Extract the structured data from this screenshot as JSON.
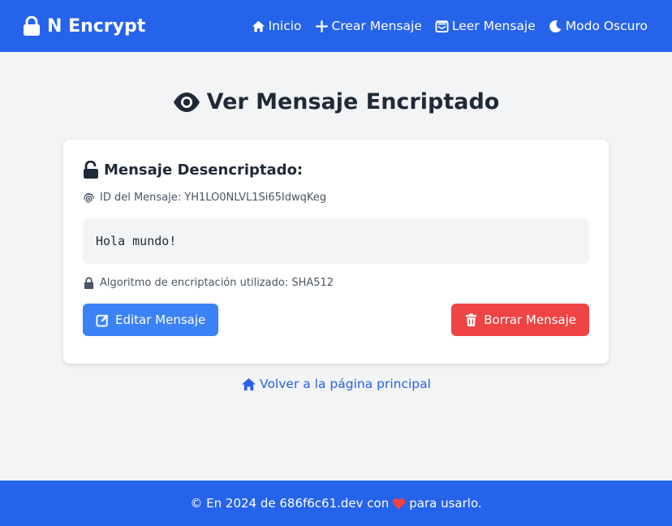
{
  "navbar": {
    "brand": "N Encrypt",
    "links": [
      {
        "label": "Inicio",
        "icon": "home-icon"
      },
      {
        "label": "Crear Mensaje",
        "icon": "plus-icon"
      },
      {
        "label": "Leer Mensaje",
        "icon": "envelope-open-icon"
      },
      {
        "label": "Modo Oscuro",
        "icon": "moon-icon"
      }
    ]
  },
  "page": {
    "title": "Ver Mensaje Encriptado"
  },
  "card": {
    "title": "Mensaje Desencriptado:",
    "id_text": "ID del Mensaje: YH1LO0NLVL1Si65IdwqKeg",
    "message": "Hola mundo!",
    "algorithm_text": "Algoritmo de encriptación utilizado: SHA512",
    "edit_label": "Editar Mensaje",
    "delete_label": "Borrar Mensaje"
  },
  "back_link": "Volver a la página principal",
  "footer": {
    "before": "© En 2024 de 686f6c61.dev con",
    "after": "para usarlo."
  },
  "colors": {
    "primary": "#2563eb",
    "edit_button": "#3b82f6",
    "delete_button": "#ef4444",
    "heart": "#ef4444"
  }
}
